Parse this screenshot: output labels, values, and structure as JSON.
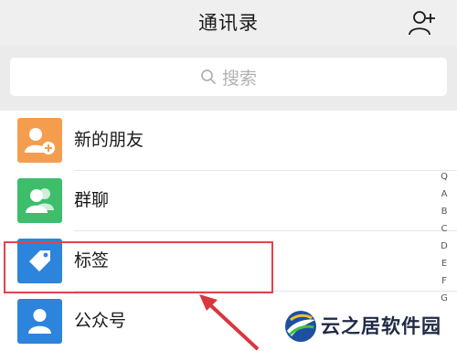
{
  "header": {
    "title": "通讯录",
    "add_contact_icon": "person-plus-icon"
  },
  "search": {
    "placeholder": "搜索",
    "icon": "search-icon"
  },
  "contacts_list": {
    "items": [
      {
        "label": "新的朋友",
        "icon": "person-plus-icon",
        "color": "#f59d4f"
      },
      {
        "label": "群聊",
        "icon": "group-icon",
        "color": "#3ebd6b"
      },
      {
        "label": "标签",
        "icon": "tag-icon",
        "color": "#2c84dc"
      },
      {
        "label": "公众号",
        "icon": "person-icon",
        "color": "#2c84dc"
      }
    ]
  },
  "index_bar": {
    "letters": [
      "Q",
      "A",
      "B",
      "C",
      "D",
      "E",
      "F",
      "G"
    ]
  },
  "annotation": {
    "highlight_color": "#e0434d"
  },
  "watermark": {
    "text": "云之居软件园"
  }
}
